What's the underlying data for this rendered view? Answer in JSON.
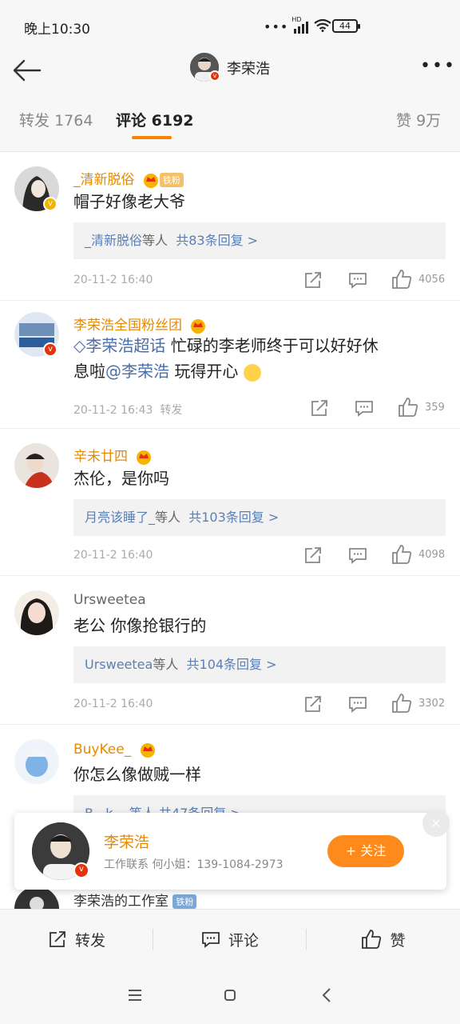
{
  "status_bar": {
    "time": "晚上10:30",
    "signal_label": "HD",
    "battery": "44"
  },
  "header": {
    "title": "李荣浩"
  },
  "tabs": [
    {
      "label": "转发",
      "count": "1764"
    },
    {
      "label": "评论",
      "count": "6192"
    },
    {
      "label": "赞",
      "count": "9万"
    }
  ],
  "comments": [
    {
      "username": "_清新脱俗",
      "tag": "铁粉",
      "text": "帽子好像老大爷",
      "reply_user": "_清新脱俗",
      "reply_mid": "等人",
      "reply_count": "共83条回复 >",
      "time": "20-11-2 16:40",
      "likes": "4056"
    },
    {
      "username": "李荣浩全国粉丝团",
      "text_link1": "李荣浩超话",
      "text_plain1": " 忙碌的李老师终于可以好好休",
      "text_line2_plain": "息啦",
      "text_link2": "@李荣浩",
      "text_plain2": " 玩得开心",
      "time": "20-11-2 16:43",
      "repost_label": "转发",
      "likes": "359"
    },
    {
      "username": "辛未廿四",
      "text": "杰伦，是你吗",
      "reply_user": "月亮该睡了_",
      "reply_mid": "等人",
      "reply_count": "共103条回复 >",
      "time": "20-11-2 16:40",
      "likes": "4098"
    },
    {
      "username": "Ursweetea",
      "text": "老公 你像抢银行的",
      "reply_user": "Ursweetea",
      "reply_mid": "等人",
      "reply_count": "共104条回复 >",
      "time": "20-11-2 16:40",
      "likes": "3302"
    },
    {
      "username": "BuyKee_",
      "text": "你怎么像做贼一样",
      "reply_partial": "B...k...  等人  共47条回复 >"
    },
    {
      "username": "李荣浩的工作室",
      "tag": "铁粉"
    }
  ],
  "follow_popup": {
    "name": "李荣浩",
    "desc": "工作联系  何小姐：139-1084-2973",
    "button": "+ 关注",
    "close": "×"
  },
  "action_bar": {
    "repost": "转发",
    "comment": "评论",
    "like": "赞"
  },
  "colors": {
    "accent": "#ff8200",
    "username": "#e68a00",
    "link": "#4a6ea9"
  }
}
